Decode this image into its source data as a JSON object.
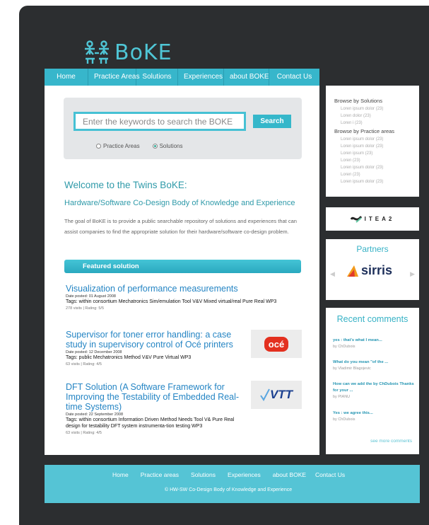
{
  "site": {
    "logo_text": "BoKE"
  },
  "topnav": [
    "Home",
    "Practice Areas",
    "Solutions",
    "Experiences",
    "about BOKE",
    "Contact Us"
  ],
  "search": {
    "placeholder": "Enter the keywords to search the BOKE",
    "button": "Search",
    "options": [
      "Practice Areas",
      "Solutions"
    ],
    "selected": "Solutions"
  },
  "welcome": {
    "title": "Welcome to the Twins BoKE:",
    "subtitle": "Hardware/Software Co-Design Body of Knowledge and Experience",
    "text": "The goal of BoKE is to provide a public searchable repository of solutions and experiences that can assist companies to find the appropriate solution for their hardware/software co-design problem."
  },
  "featured": {
    "label": "Featured solution",
    "items": [
      {
        "title": "Visualization of performance measurements",
        "date": "Date posted: 01 August 2008",
        "tags": "Tags: within consortium  Mechatronics  Sim/emulation  Tool  V&V  Mixed virtual/real Pure Real  WP3",
        "stats": "278 visits | Rating: 5/5"
      },
      {
        "title": "Supervisor for toner error handling: a case study in supervisory control of Océ printers",
        "date": "Date posted: 12 December 2008",
        "tags": "Tags: public  Mechatronics  Method  V&V  Pure  Virtual  WP3",
        "stats": "63 visits | Rating: 4/5",
        "logo": "océ"
      },
      {
        "title": "DFT Solution (A Software Framework for Improving the Testability of Embedded Real-time Systems)",
        "date": "Date posted: 22 September 2008",
        "tags": "Tags: within consortium        Information Driven        Method        Needs Tool V&   Pure Real   design for testability  DFT  system instrumenta-tion    testing    WP3",
        "stats": "63 visits | Rating: 4/5",
        "logo": "VTT"
      }
    ]
  },
  "sidebar": {
    "browse_solutions": {
      "heading": "Browse by Solutions",
      "items": [
        "Loren ipsum dolor (23)",
        "Loren  dolor (23)",
        "Loren i (23)"
      ]
    },
    "browse_practice": {
      "heading": "Browse by Practice areas",
      "items": [
        "Loren ipsum dolor (23)",
        "Loren ipsum dolor (23)",
        "Loren ipsum  (23)",
        "Loren (23)",
        "Loren ipsum dolor (23)",
        "Loren (23)",
        "Loren ipsum dolor (23)"
      ]
    },
    "itea_text": "ITEA2",
    "partners_title": "Partners",
    "partner_name": "sirris",
    "recent_title": "Recent comments",
    "comments": [
      {
        "text": "yes : that's what I mean...",
        "by": "by ChDubois"
      },
      {
        "text": "What do you mean \"of the ...",
        "by": "by Vladimir Blagojevic"
      },
      {
        "text": "How can we add the by ChDubois Thanks for your ...",
        "by": "by PIANU"
      },
      {
        "text": "Yes : we agree this...",
        "by": "by ChDubois"
      }
    ],
    "see_more": "see more comments"
  },
  "footer": {
    "nav": [
      "Home",
      "Practice areas",
      "Solutions",
      "Experiences",
      "about BOKE",
      "Contact Us"
    ],
    "copyright": "©  HW-SW Co-Design Body of Knowledge and Experience"
  },
  "colors": {
    "accent": "#37b6cb",
    "link": "#2585c4",
    "frame": "#2c2e30"
  }
}
